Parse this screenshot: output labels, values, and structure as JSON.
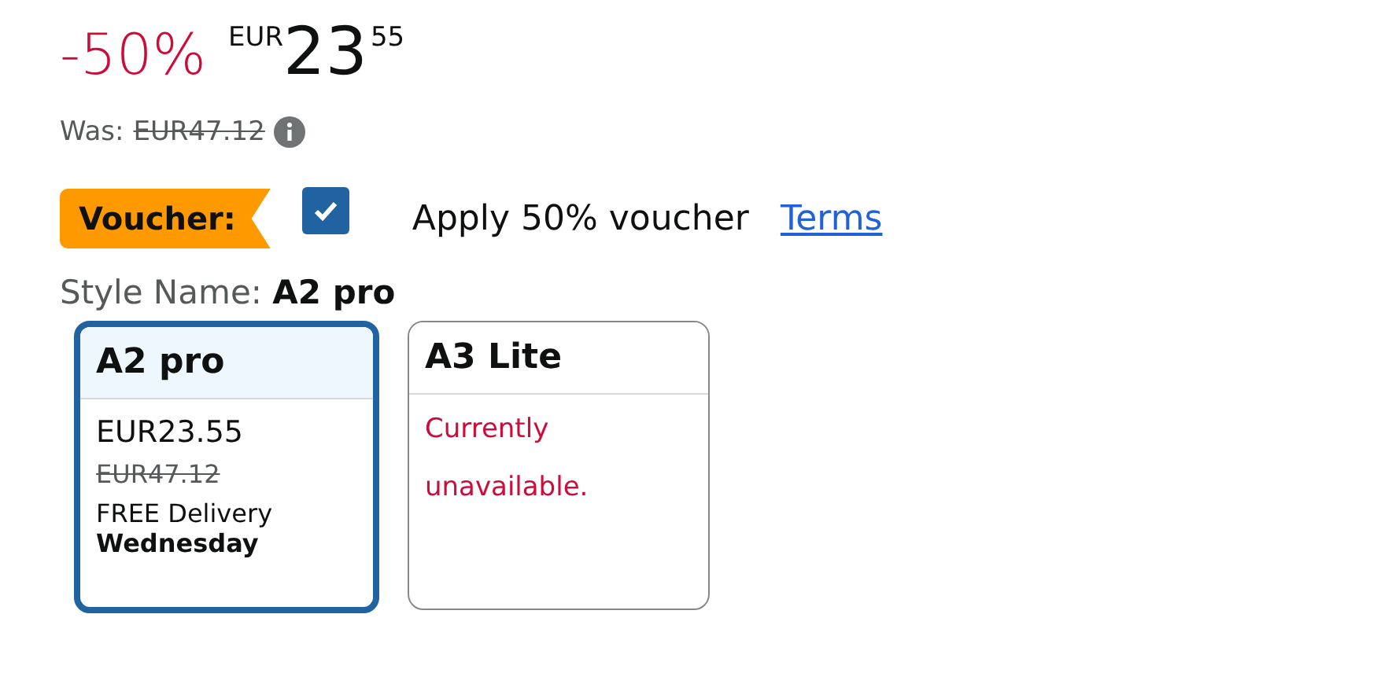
{
  "price": {
    "discount": "-50%",
    "currency": "EUR",
    "whole": "23",
    "fraction": "55"
  },
  "was": {
    "label": "Was:",
    "price": "EUR47.12"
  },
  "voucher": {
    "badge": "Voucher:",
    "checked": true,
    "label": "Apply 50% voucher",
    "link": "Terms"
  },
  "style": {
    "label": "Style Name:",
    "value": "A2 pro"
  },
  "options": [
    {
      "kind": "available",
      "name": "A2 pro",
      "selected": true,
      "price": "EUR23.55",
      "was": "EUR47.12",
      "delivery": "FREE Delivery",
      "delivery_day": "Wednesday"
    },
    {
      "kind": "unavailable",
      "name": "A3 Lite",
      "selected": false,
      "status": "Currently unavailable."
    }
  ]
}
